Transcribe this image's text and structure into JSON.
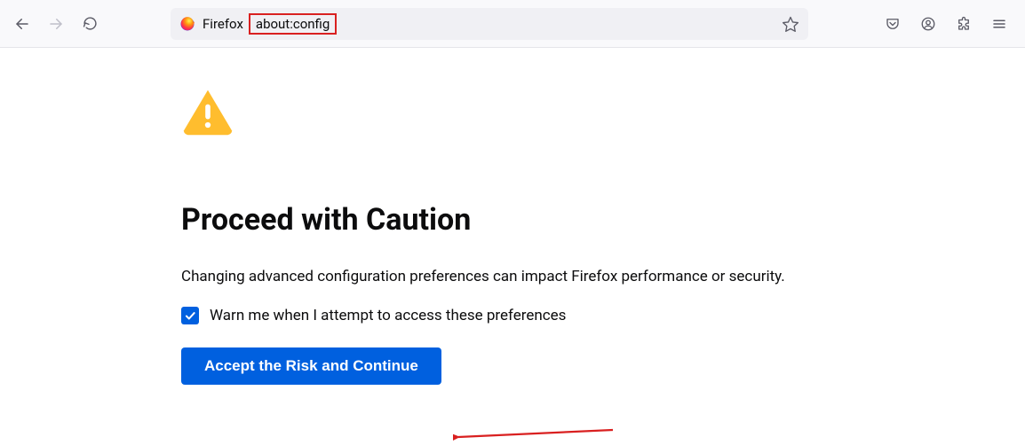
{
  "toolbar": {
    "site_label": "Firefox",
    "url_text": "about:config"
  },
  "page": {
    "heading": "Proceed with Caution",
    "description": "Changing advanced configuration preferences can impact Firefox performance or security.",
    "checkbox_label": "Warn me when I attempt to access these preferences",
    "accept_button": "Accept the Risk and Continue"
  }
}
